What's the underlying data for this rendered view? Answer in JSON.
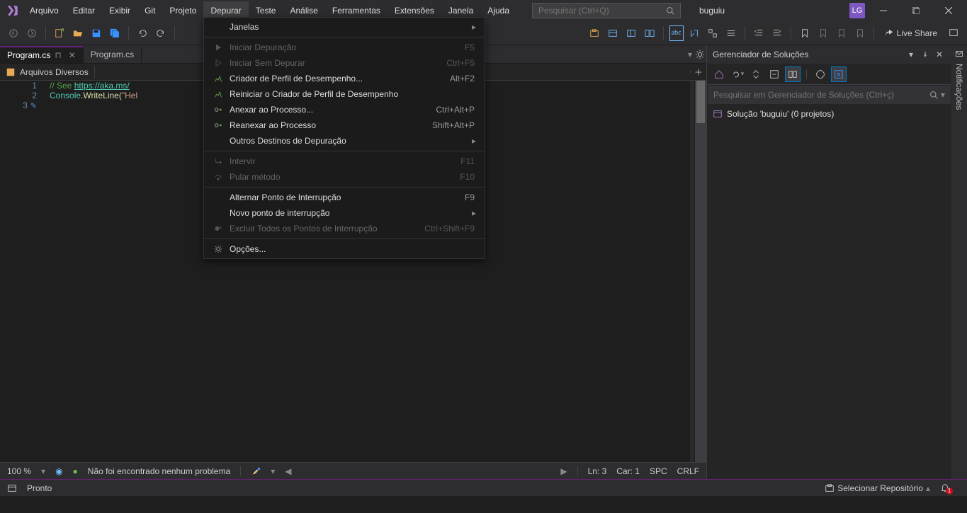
{
  "title": {
    "project": "buguiu",
    "avatar": "LG"
  },
  "menu": [
    "Arquivo",
    "Editar",
    "Exibir",
    "Git",
    "Projeto",
    "Depurar",
    "Teste",
    "Análise",
    "Ferramentas",
    "Extensões",
    "Janela",
    "Ajuda"
  ],
  "active_menu_idx": 5,
  "search": {
    "placeholder": "Pesquisar (Ctrl+Q)"
  },
  "live_share": "Live Share",
  "tabs": [
    {
      "label": "Program.cs",
      "active": true,
      "pinned": true
    },
    {
      "label": "Program.cs",
      "active": false
    }
  ],
  "nav_combo": {
    "label": "Arquivos Diversos"
  },
  "code": {
    "lines": [
      {
        "n": 1,
        "kind": "comment",
        "prefix": "// See ",
        "link": "https://aka.ms/"
      },
      {
        "n": 2,
        "kind": "code",
        "type": "Console",
        "method": "WriteLine",
        "string": "\"Hel"
      },
      {
        "n": 3,
        "kind": "empty",
        "margin": "brush"
      }
    ]
  },
  "editor_status": {
    "zoom": "100 %",
    "issues": "Não foi encontrado nenhum problema",
    "ln": "Ln: 3",
    "car": "Car: 1",
    "spc": "SPC",
    "crlf": "CRLF"
  },
  "solution_explorer": {
    "title": "Gerenciador de Soluções",
    "search_placeholder": "Pesquisar em Gerenciador de Soluções (Ctrl+ç)",
    "root": "Solução 'buguiu' (0 projetos)"
  },
  "right_rail": "Notificações",
  "status_bar": {
    "ready": "Pronto",
    "repo": "Selecionar Repositório",
    "bell_count": "1"
  },
  "dropdown": {
    "items": [
      {
        "label": "Janelas",
        "shortcut": "",
        "submenu": true,
        "disabled": false,
        "icon": ""
      },
      {
        "sep": true
      },
      {
        "label": "Iniciar Depuração",
        "shortcut": "F5",
        "disabled": true,
        "icon": "play"
      },
      {
        "label": "Iniciar Sem Depurar",
        "shortcut": "Ctrl+F5",
        "disabled": true,
        "icon": "play-outline"
      },
      {
        "label": "Criador de Perfil de Desempenho...",
        "shortcut": "Alt+F2",
        "disabled": false,
        "icon": "perf"
      },
      {
        "label": "Reiniciar o Criador de Perfil de Desempenho",
        "shortcut": "",
        "disabled": false,
        "icon": "perf"
      },
      {
        "label": "Anexar ao Processo...",
        "shortcut": "Ctrl+Alt+P",
        "disabled": false,
        "icon": "attach"
      },
      {
        "label": "Reanexar ao Processo",
        "shortcut": "Shift+Alt+P",
        "disabled": false,
        "icon": "attach"
      },
      {
        "label": "Outros Destinos de Depuração",
        "shortcut": "",
        "submenu": true,
        "disabled": false,
        "icon": ""
      },
      {
        "sep": true
      },
      {
        "label": "Intervir",
        "shortcut": "F11",
        "disabled": true,
        "icon": "step"
      },
      {
        "label": "Pular método",
        "shortcut": "F10",
        "disabled": true,
        "icon": "stepover"
      },
      {
        "sep": true
      },
      {
        "label": "Alternar Ponto de Interrupção",
        "shortcut": "F9",
        "disabled": false,
        "icon": ""
      },
      {
        "label": "Novo ponto de interrupção",
        "shortcut": "",
        "submenu": true,
        "disabled": false,
        "icon": ""
      },
      {
        "label": "Excluir Todos os Pontos de Interrupção",
        "shortcut": "Ctrl+Shift+F9",
        "disabled": true,
        "icon": "bp-del"
      },
      {
        "sep": true
      },
      {
        "label": "Opções...",
        "shortcut": "",
        "disabled": false,
        "icon": "gear"
      }
    ]
  }
}
